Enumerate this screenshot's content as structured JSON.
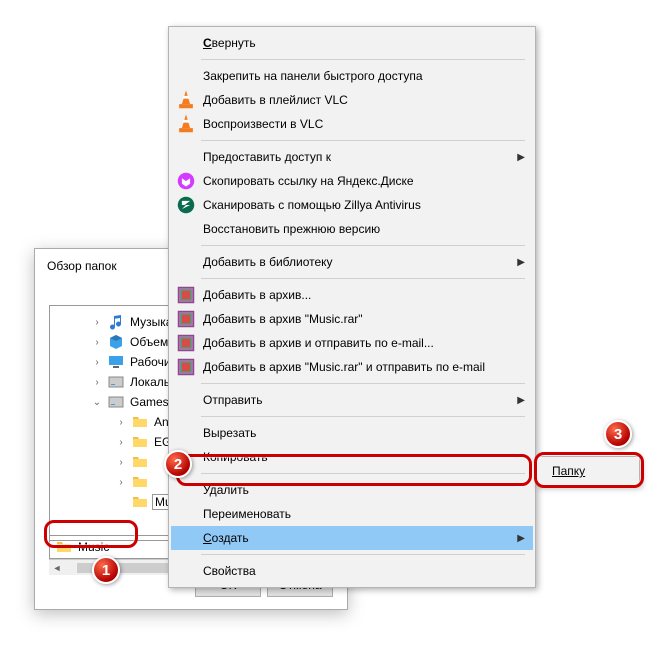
{
  "dialog": {
    "title": "Обзор папок",
    "ok": "OK",
    "cancel": "Отмена",
    "path_label": "Music"
  },
  "tree": {
    "items": [
      {
        "indent": 40,
        "expander": "›",
        "icon": "music",
        "label": "Музыка"
      },
      {
        "indent": 40,
        "expander": "›",
        "icon": "objects",
        "label": "Объемн"
      },
      {
        "indent": 40,
        "expander": "›",
        "icon": "desktop",
        "label": "Рабочи"
      },
      {
        "indent": 40,
        "expander": "›",
        "icon": "disk",
        "label": "Локаль"
      },
      {
        "indent": 40,
        "expander": "⌄",
        "icon": "disk",
        "label": "Games"
      },
      {
        "indent": 64,
        "expander": "›",
        "icon": "folder",
        "label": "And"
      },
      {
        "indent": 64,
        "expander": "›",
        "icon": "folder",
        "label": "EGS"
      },
      {
        "indent": 64,
        "expander": "›",
        "icon": "folder",
        "label": ""
      },
      {
        "indent": 64,
        "expander": "›",
        "icon": "folder",
        "label": ""
      },
      {
        "indent": 64,
        "expander": "",
        "icon": "folder",
        "label": "",
        "edit": "Music"
      }
    ]
  },
  "context_menu": {
    "items": [
      {
        "type": "item",
        "label": "Свернуть",
        "underline": true,
        "bold": true
      },
      {
        "type": "sep"
      },
      {
        "type": "item",
        "label": "Закрепить на панели быстрого доступа"
      },
      {
        "type": "item",
        "label": "Добавить в плейлист VLC",
        "icon": "vlc"
      },
      {
        "type": "item",
        "label": "Воспроизвести в VLC",
        "icon": "vlc"
      },
      {
        "type": "sep"
      },
      {
        "type": "item",
        "label": "Предоставить доступ к",
        "submenu": true
      },
      {
        "type": "item",
        "label": "Скопировать ссылку на Яндекс.Диске",
        "icon": "yadisk"
      },
      {
        "type": "item",
        "label": "Сканировать с помощью Zillya Antivirus",
        "icon": "zillya"
      },
      {
        "type": "item",
        "label": "Восстановить прежнюю версию"
      },
      {
        "type": "sep"
      },
      {
        "type": "item",
        "label": "Добавить в библиотеку",
        "submenu": true
      },
      {
        "type": "sep"
      },
      {
        "type": "item",
        "label": "Добавить в архив...",
        "icon": "rar"
      },
      {
        "type": "item",
        "label": "Добавить в архив \"Music.rar\"",
        "icon": "rar"
      },
      {
        "type": "item",
        "label": "Добавить в архив и отправить по e-mail...",
        "icon": "rar"
      },
      {
        "type": "item",
        "label": "Добавить в архив \"Music.rar\" и отправить по e-mail",
        "icon": "rar"
      },
      {
        "type": "sep"
      },
      {
        "type": "item",
        "label": "Отправить",
        "submenu": true
      },
      {
        "type": "sep"
      },
      {
        "type": "item",
        "label": "Вырезать"
      },
      {
        "type": "item",
        "label": "Копировать"
      },
      {
        "type": "sep"
      },
      {
        "type": "item",
        "label": "Удалить"
      },
      {
        "type": "item",
        "label": "Переименовать"
      },
      {
        "type": "item",
        "label": "Создать",
        "submenu": true,
        "highlight": true,
        "underline": true
      },
      {
        "type": "sep"
      },
      {
        "type": "item",
        "label": "Свойства"
      }
    ]
  },
  "submenu": {
    "label": "Папку"
  },
  "badges": {
    "1": "1",
    "2": "2",
    "3": "3"
  }
}
